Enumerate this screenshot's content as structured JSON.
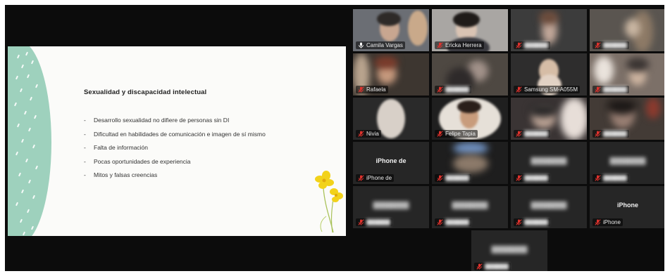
{
  "slide": {
    "title": "Sexualidad y discapacidad intelectual",
    "bullets": [
      "Desarrollo sexualidad no difiere de personas sin DI",
      "Dificultad en habilidades de comunicación e imagen de sí mismo",
      "Falta de información",
      "Pocas oportunidades de experiencia",
      "Mitos y falsas creencias"
    ],
    "bullet_marker": "-",
    "colors": {
      "leaf": "#9ed1bd",
      "flower": "#f2d21a"
    }
  },
  "gallery": {
    "colors": {
      "active_border": "#3fd07a",
      "muted_mic": "#e0322d"
    },
    "participants": [
      {
        "name": "Camila Vargas",
        "active": true,
        "muted": false,
        "blurred": false,
        "video": true
      },
      {
        "name": "Ericka Herrera",
        "muted": true,
        "blurred": false,
        "video": true
      },
      {
        "name": "",
        "muted": true,
        "blurred": true,
        "video": true
      },
      {
        "name": "",
        "muted": true,
        "blurred": true,
        "video": true
      },
      {
        "name": "Rafaela",
        "muted": true,
        "blurred": true,
        "video": true
      },
      {
        "name": "",
        "muted": true,
        "blurred": true,
        "video": true
      },
      {
        "name": "Samsung SM-A055M",
        "muted": true,
        "blurred": false,
        "video": true
      },
      {
        "name": "",
        "muted": true,
        "blurred": true,
        "video": true
      },
      {
        "name": "Nivia",
        "muted": true,
        "blurred": false,
        "video": true
      },
      {
        "name": "Felipe Tapia",
        "muted": true,
        "blurred": false,
        "video": true
      },
      {
        "name": "",
        "muted": true,
        "blurred": true,
        "video": true
      },
      {
        "name": "",
        "muted": true,
        "blurred": true,
        "video": true
      },
      {
        "name": "iPhone de",
        "big_name": "iPhone de",
        "muted": true,
        "blurred": false,
        "video": false
      },
      {
        "name": "",
        "muted": true,
        "blurred": true,
        "video": true
      },
      {
        "name": "",
        "big_name": "",
        "muted": true,
        "blurred": true,
        "video": false
      },
      {
        "name": "",
        "big_name": "",
        "muted": true,
        "blurred": true,
        "video": false
      },
      {
        "name": "",
        "big_name": "",
        "muted": true,
        "blurred": true,
        "video": false
      },
      {
        "name": "",
        "big_name": "",
        "muted": true,
        "blurred": true,
        "video": false
      },
      {
        "name": "",
        "big_name": "",
        "muted": true,
        "blurred": true,
        "video": false
      },
      {
        "name": "iPhone",
        "big_name": "iPhone",
        "muted": true,
        "blurred": false,
        "video": false
      },
      {
        "name": "",
        "big_name": "",
        "muted": true,
        "blurred": true,
        "video": false
      }
    ]
  }
}
